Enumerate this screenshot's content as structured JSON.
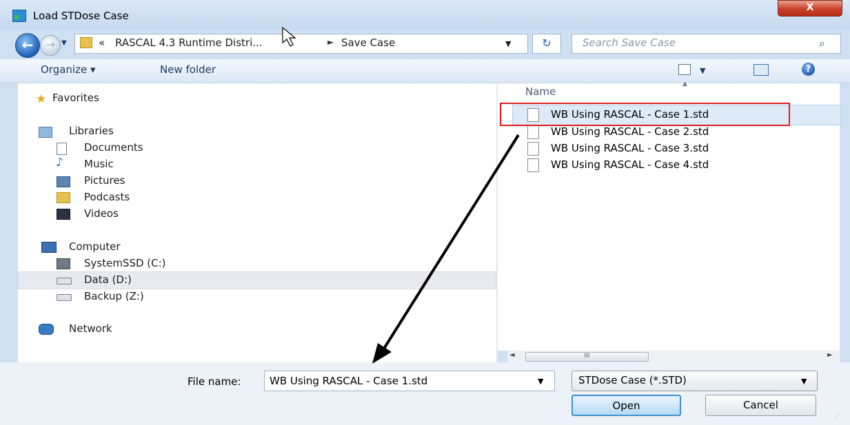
{
  "window": {
    "title": "Load STDose Case",
    "close_label": "X"
  },
  "nav_buttons": {
    "back_glyph": "←",
    "forward_glyph": "→",
    "history_glyph": "▼"
  },
  "address": {
    "overflow": "«",
    "crumbs": [
      "RASCAL 4.3 Runtime Distri...",
      "Save Case"
    ],
    "separator": "►",
    "dropdown_glyph": "▼",
    "refresh_glyph": "↻"
  },
  "search": {
    "placeholder": "Search Save Case",
    "icon": "search-icon"
  },
  "toolbar": {
    "organize_label": "Organize ▾",
    "new_folder_label": "New folder",
    "views_drop_glyph": "▼",
    "help_glyph": "?"
  },
  "nav_pane": {
    "favorites": "Favorites",
    "libraries": "Libraries",
    "library_items": [
      "Documents",
      "Music",
      "Pictures",
      "Podcasts",
      "Videos"
    ],
    "computer": "Computer",
    "drives": [
      "SystemSSD (C:)",
      "Data (D:)",
      "Backup (Z:)"
    ],
    "network": "Network"
  },
  "file_list": {
    "header_name": "Name",
    "sort_glyph": "▲",
    "files": [
      "WB Using RASCAL - Case 1.std",
      "WB Using RASCAL - Case 2.std",
      "WB Using RASCAL - Case 3.std",
      "WB Using RASCAL - Case 4.std"
    ],
    "selected_index": 0
  },
  "scrollbar": {
    "left_glyph": "◄",
    "thumb_glyph": "III",
    "right_glyph": "►"
  },
  "bottom": {
    "filename_label": "File name:",
    "filename_value": "WB Using RASCAL - Case 1.std",
    "filename_drop_glyph": "▼",
    "filetype_value": "STDose Case (*.STD)",
    "filetype_drop_glyph": "▼",
    "open_label": "Open",
    "cancel_label": "Cancel"
  },
  "colors": {
    "highlight_box": "#e01b1b",
    "selection": "#dfeaf8",
    "accent": "#3d8fd0"
  }
}
